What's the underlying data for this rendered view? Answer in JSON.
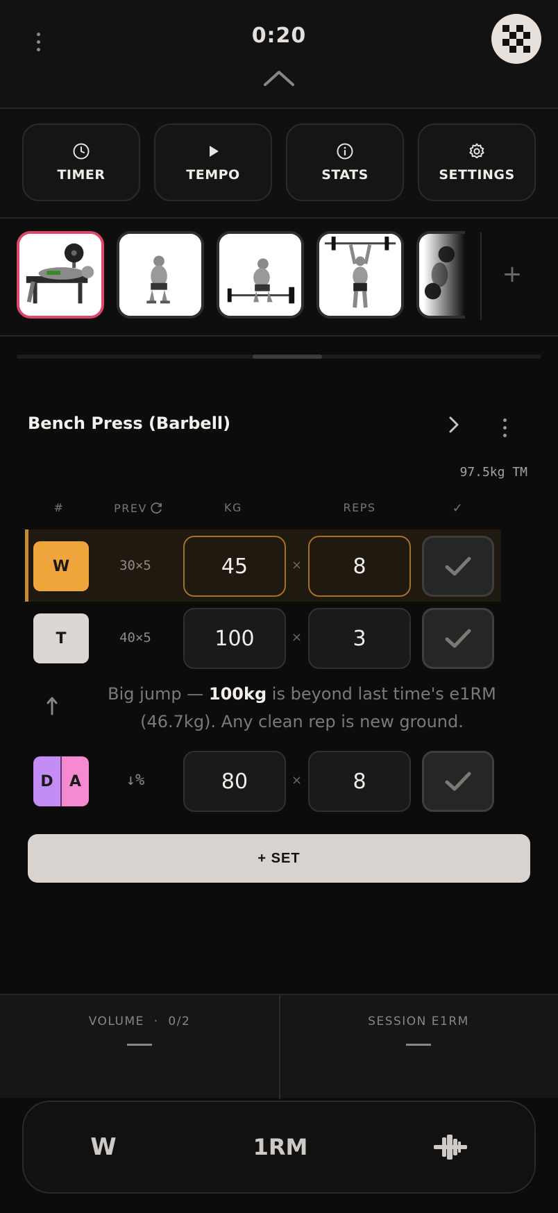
{
  "header": {
    "timer": "0:20"
  },
  "tools": [
    {
      "label": "TIMER",
      "icon": "clock-icon"
    },
    {
      "label": "TEMPO",
      "icon": "play-icon"
    },
    {
      "label": "STATS",
      "icon": "info-icon"
    },
    {
      "label": "SETTINGS",
      "icon": "gear-icon"
    }
  ],
  "strip": {
    "add_label": "+"
  },
  "exercise": {
    "title": "Bench Press (Barbell)",
    "training_max": "97.5kg TM"
  },
  "columns": {
    "num": "#",
    "prev": "PREV",
    "kg": "KG",
    "reps": "REPS",
    "done": "✓"
  },
  "sets": [
    {
      "type": "W",
      "prev": "30×5",
      "kg": "45",
      "reps": "8",
      "highlighted": true
    },
    {
      "type": "T",
      "prev": "40×5",
      "kg": "100",
      "reps": "3"
    },
    {
      "type_left": "D",
      "type_right": "A",
      "prev": "↓%",
      "kg": "80",
      "reps": "8"
    }
  ],
  "times_sign": "×",
  "note": {
    "before": "Big jump — ",
    "bold": "100kg",
    "after": " is beyond last time's e1RM (46.7kg). Any clean rep is new ground."
  },
  "add_set_label": "+ SET",
  "stats": {
    "volume_label": "VOLUME  ·  0/2",
    "e1rm_label": "SESSION E1RM"
  },
  "nav": {
    "w": "W",
    "one_rm": "1RM"
  },
  "colors": {
    "accent_pink": "#e0456b",
    "warmup": "#f0a53c",
    "drop": "#c48cf5",
    "amrap": "#f58ad2"
  }
}
